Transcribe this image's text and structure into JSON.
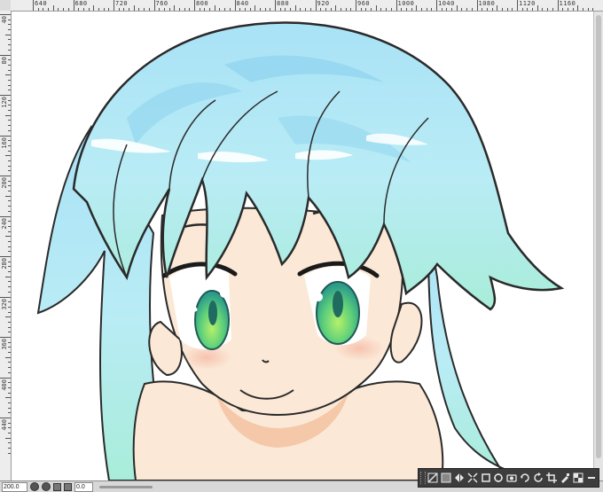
{
  "ruler": {
    "top_labels": [
      "640",
      "680",
      "720",
      "760",
      "800",
      "840",
      "880",
      "920",
      "960",
      "1000",
      "1040",
      "1080",
      "1120",
      "1160"
    ],
    "left_labels": [
      "40",
      "80",
      "120",
      "160",
      "200",
      "240",
      "280",
      "320",
      "360",
      "400",
      "440"
    ]
  },
  "status": {
    "zoom": "200.0",
    "angle": "0.0"
  },
  "toolbar": {
    "buttons": [
      "navigator-icon",
      "grayscale-icon",
      "flip-horizontal-icon",
      "fit-screen-icon",
      "rotate-icon",
      "actual-size-icon",
      "zoom-out-icon",
      "zoom-in-icon",
      "reset-view-icon",
      "crop-icon",
      "brush-preview-icon",
      "checker-icon",
      "minimize-icon"
    ]
  },
  "colors": {
    "hair": "#b5e9f4",
    "hair_shadow": "#8fd3ef",
    "hair_tip": "#a6ecd8",
    "skin": "#fbe8d6",
    "skin_shadow": "#f3c8a6",
    "eye_iris": "#6fd36a",
    "line": "#2a2a2a"
  }
}
